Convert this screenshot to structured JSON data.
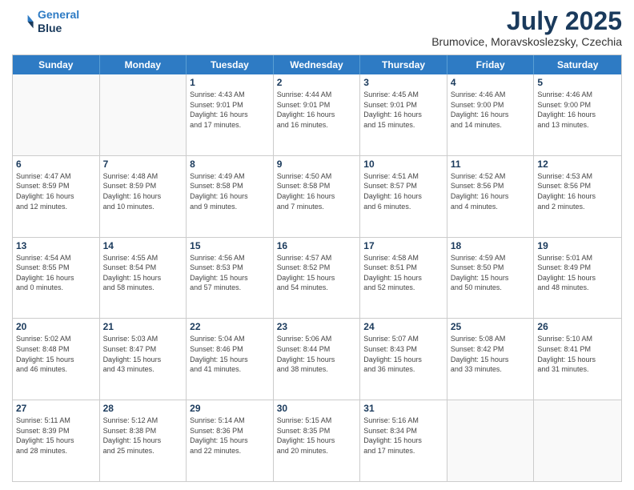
{
  "header": {
    "logo_line1": "General",
    "logo_line2": "Blue",
    "month_title": "July 2025",
    "location": "Brumovice, Moravskoslezsky, Czechia"
  },
  "days_of_week": [
    "Sunday",
    "Monday",
    "Tuesday",
    "Wednesday",
    "Thursday",
    "Friday",
    "Saturday"
  ],
  "weeks": [
    [
      {
        "day": "",
        "empty": true
      },
      {
        "day": "",
        "empty": true
      },
      {
        "day": "1",
        "line1": "Sunrise: 4:43 AM",
        "line2": "Sunset: 9:01 PM",
        "line3": "Daylight: 16 hours",
        "line4": "and 17 minutes."
      },
      {
        "day": "2",
        "line1": "Sunrise: 4:44 AM",
        "line2": "Sunset: 9:01 PM",
        "line3": "Daylight: 16 hours",
        "line4": "and 16 minutes."
      },
      {
        "day": "3",
        "line1": "Sunrise: 4:45 AM",
        "line2": "Sunset: 9:01 PM",
        "line3": "Daylight: 16 hours",
        "line4": "and 15 minutes."
      },
      {
        "day": "4",
        "line1": "Sunrise: 4:46 AM",
        "line2": "Sunset: 9:00 PM",
        "line3": "Daylight: 16 hours",
        "line4": "and 14 minutes."
      },
      {
        "day": "5",
        "line1": "Sunrise: 4:46 AM",
        "line2": "Sunset: 9:00 PM",
        "line3": "Daylight: 16 hours",
        "line4": "and 13 minutes."
      }
    ],
    [
      {
        "day": "6",
        "line1": "Sunrise: 4:47 AM",
        "line2": "Sunset: 8:59 PM",
        "line3": "Daylight: 16 hours",
        "line4": "and 12 minutes."
      },
      {
        "day": "7",
        "line1": "Sunrise: 4:48 AM",
        "line2": "Sunset: 8:59 PM",
        "line3": "Daylight: 16 hours",
        "line4": "and 10 minutes."
      },
      {
        "day": "8",
        "line1": "Sunrise: 4:49 AM",
        "line2": "Sunset: 8:58 PM",
        "line3": "Daylight: 16 hours",
        "line4": "and 9 minutes."
      },
      {
        "day": "9",
        "line1": "Sunrise: 4:50 AM",
        "line2": "Sunset: 8:58 PM",
        "line3": "Daylight: 16 hours",
        "line4": "and 7 minutes."
      },
      {
        "day": "10",
        "line1": "Sunrise: 4:51 AM",
        "line2": "Sunset: 8:57 PM",
        "line3": "Daylight: 16 hours",
        "line4": "and 6 minutes."
      },
      {
        "day": "11",
        "line1": "Sunrise: 4:52 AM",
        "line2": "Sunset: 8:56 PM",
        "line3": "Daylight: 16 hours",
        "line4": "and 4 minutes."
      },
      {
        "day": "12",
        "line1": "Sunrise: 4:53 AM",
        "line2": "Sunset: 8:56 PM",
        "line3": "Daylight: 16 hours",
        "line4": "and 2 minutes."
      }
    ],
    [
      {
        "day": "13",
        "line1": "Sunrise: 4:54 AM",
        "line2": "Sunset: 8:55 PM",
        "line3": "Daylight: 16 hours",
        "line4": "and 0 minutes."
      },
      {
        "day": "14",
        "line1": "Sunrise: 4:55 AM",
        "line2": "Sunset: 8:54 PM",
        "line3": "Daylight: 15 hours",
        "line4": "and 58 minutes."
      },
      {
        "day": "15",
        "line1": "Sunrise: 4:56 AM",
        "line2": "Sunset: 8:53 PM",
        "line3": "Daylight: 15 hours",
        "line4": "and 57 minutes."
      },
      {
        "day": "16",
        "line1": "Sunrise: 4:57 AM",
        "line2": "Sunset: 8:52 PM",
        "line3": "Daylight: 15 hours",
        "line4": "and 54 minutes."
      },
      {
        "day": "17",
        "line1": "Sunrise: 4:58 AM",
        "line2": "Sunset: 8:51 PM",
        "line3": "Daylight: 15 hours",
        "line4": "and 52 minutes."
      },
      {
        "day": "18",
        "line1": "Sunrise: 4:59 AM",
        "line2": "Sunset: 8:50 PM",
        "line3": "Daylight: 15 hours",
        "line4": "and 50 minutes."
      },
      {
        "day": "19",
        "line1": "Sunrise: 5:01 AM",
        "line2": "Sunset: 8:49 PM",
        "line3": "Daylight: 15 hours",
        "line4": "and 48 minutes."
      }
    ],
    [
      {
        "day": "20",
        "line1": "Sunrise: 5:02 AM",
        "line2": "Sunset: 8:48 PM",
        "line3": "Daylight: 15 hours",
        "line4": "and 46 minutes."
      },
      {
        "day": "21",
        "line1": "Sunrise: 5:03 AM",
        "line2": "Sunset: 8:47 PM",
        "line3": "Daylight: 15 hours",
        "line4": "and 43 minutes."
      },
      {
        "day": "22",
        "line1": "Sunrise: 5:04 AM",
        "line2": "Sunset: 8:46 PM",
        "line3": "Daylight: 15 hours",
        "line4": "and 41 minutes."
      },
      {
        "day": "23",
        "line1": "Sunrise: 5:06 AM",
        "line2": "Sunset: 8:44 PM",
        "line3": "Daylight: 15 hours",
        "line4": "and 38 minutes."
      },
      {
        "day": "24",
        "line1": "Sunrise: 5:07 AM",
        "line2": "Sunset: 8:43 PM",
        "line3": "Daylight: 15 hours",
        "line4": "and 36 minutes."
      },
      {
        "day": "25",
        "line1": "Sunrise: 5:08 AM",
        "line2": "Sunset: 8:42 PM",
        "line3": "Daylight: 15 hours",
        "line4": "and 33 minutes."
      },
      {
        "day": "26",
        "line1": "Sunrise: 5:10 AM",
        "line2": "Sunset: 8:41 PM",
        "line3": "Daylight: 15 hours",
        "line4": "and 31 minutes."
      }
    ],
    [
      {
        "day": "27",
        "line1": "Sunrise: 5:11 AM",
        "line2": "Sunset: 8:39 PM",
        "line3": "Daylight: 15 hours",
        "line4": "and 28 minutes."
      },
      {
        "day": "28",
        "line1": "Sunrise: 5:12 AM",
        "line2": "Sunset: 8:38 PM",
        "line3": "Daylight: 15 hours",
        "line4": "and 25 minutes."
      },
      {
        "day": "29",
        "line1": "Sunrise: 5:14 AM",
        "line2": "Sunset: 8:36 PM",
        "line3": "Daylight: 15 hours",
        "line4": "and 22 minutes."
      },
      {
        "day": "30",
        "line1": "Sunrise: 5:15 AM",
        "line2": "Sunset: 8:35 PM",
        "line3": "Daylight: 15 hours",
        "line4": "and 20 minutes."
      },
      {
        "day": "31",
        "line1": "Sunrise: 5:16 AM",
        "line2": "Sunset: 8:34 PM",
        "line3": "Daylight: 15 hours",
        "line4": "and 17 minutes."
      },
      {
        "day": "",
        "empty": true
      },
      {
        "day": "",
        "empty": true
      }
    ]
  ]
}
